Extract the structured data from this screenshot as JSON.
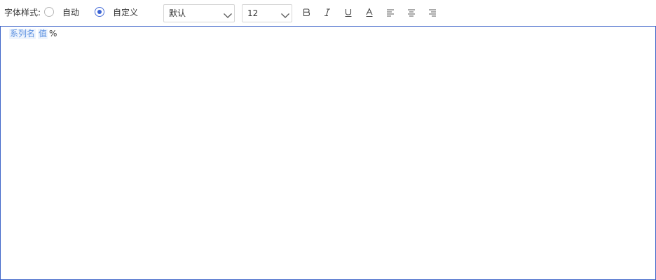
{
  "font_style": {
    "label": "字体样式:",
    "options": [
      {
        "label": "自动",
        "checked": false
      },
      {
        "label": "自定义",
        "checked": true
      }
    ]
  },
  "font_family": {
    "value": "默认"
  },
  "font_size": {
    "value": "12"
  },
  "format_icons": [
    "bold-icon",
    "italic-icon",
    "underline-icon",
    "font-color-icon",
    "align-left-icon",
    "align-center-icon",
    "align-right-icon"
  ],
  "editor": {
    "tags": [
      "系列名",
      "值"
    ],
    "suffix": "%"
  },
  "colors": {
    "accent": "#3b63d3",
    "editor_border": "#3c64c8",
    "tag_text": "#5a8fe0",
    "tag_bg": "#eef4fd"
  }
}
